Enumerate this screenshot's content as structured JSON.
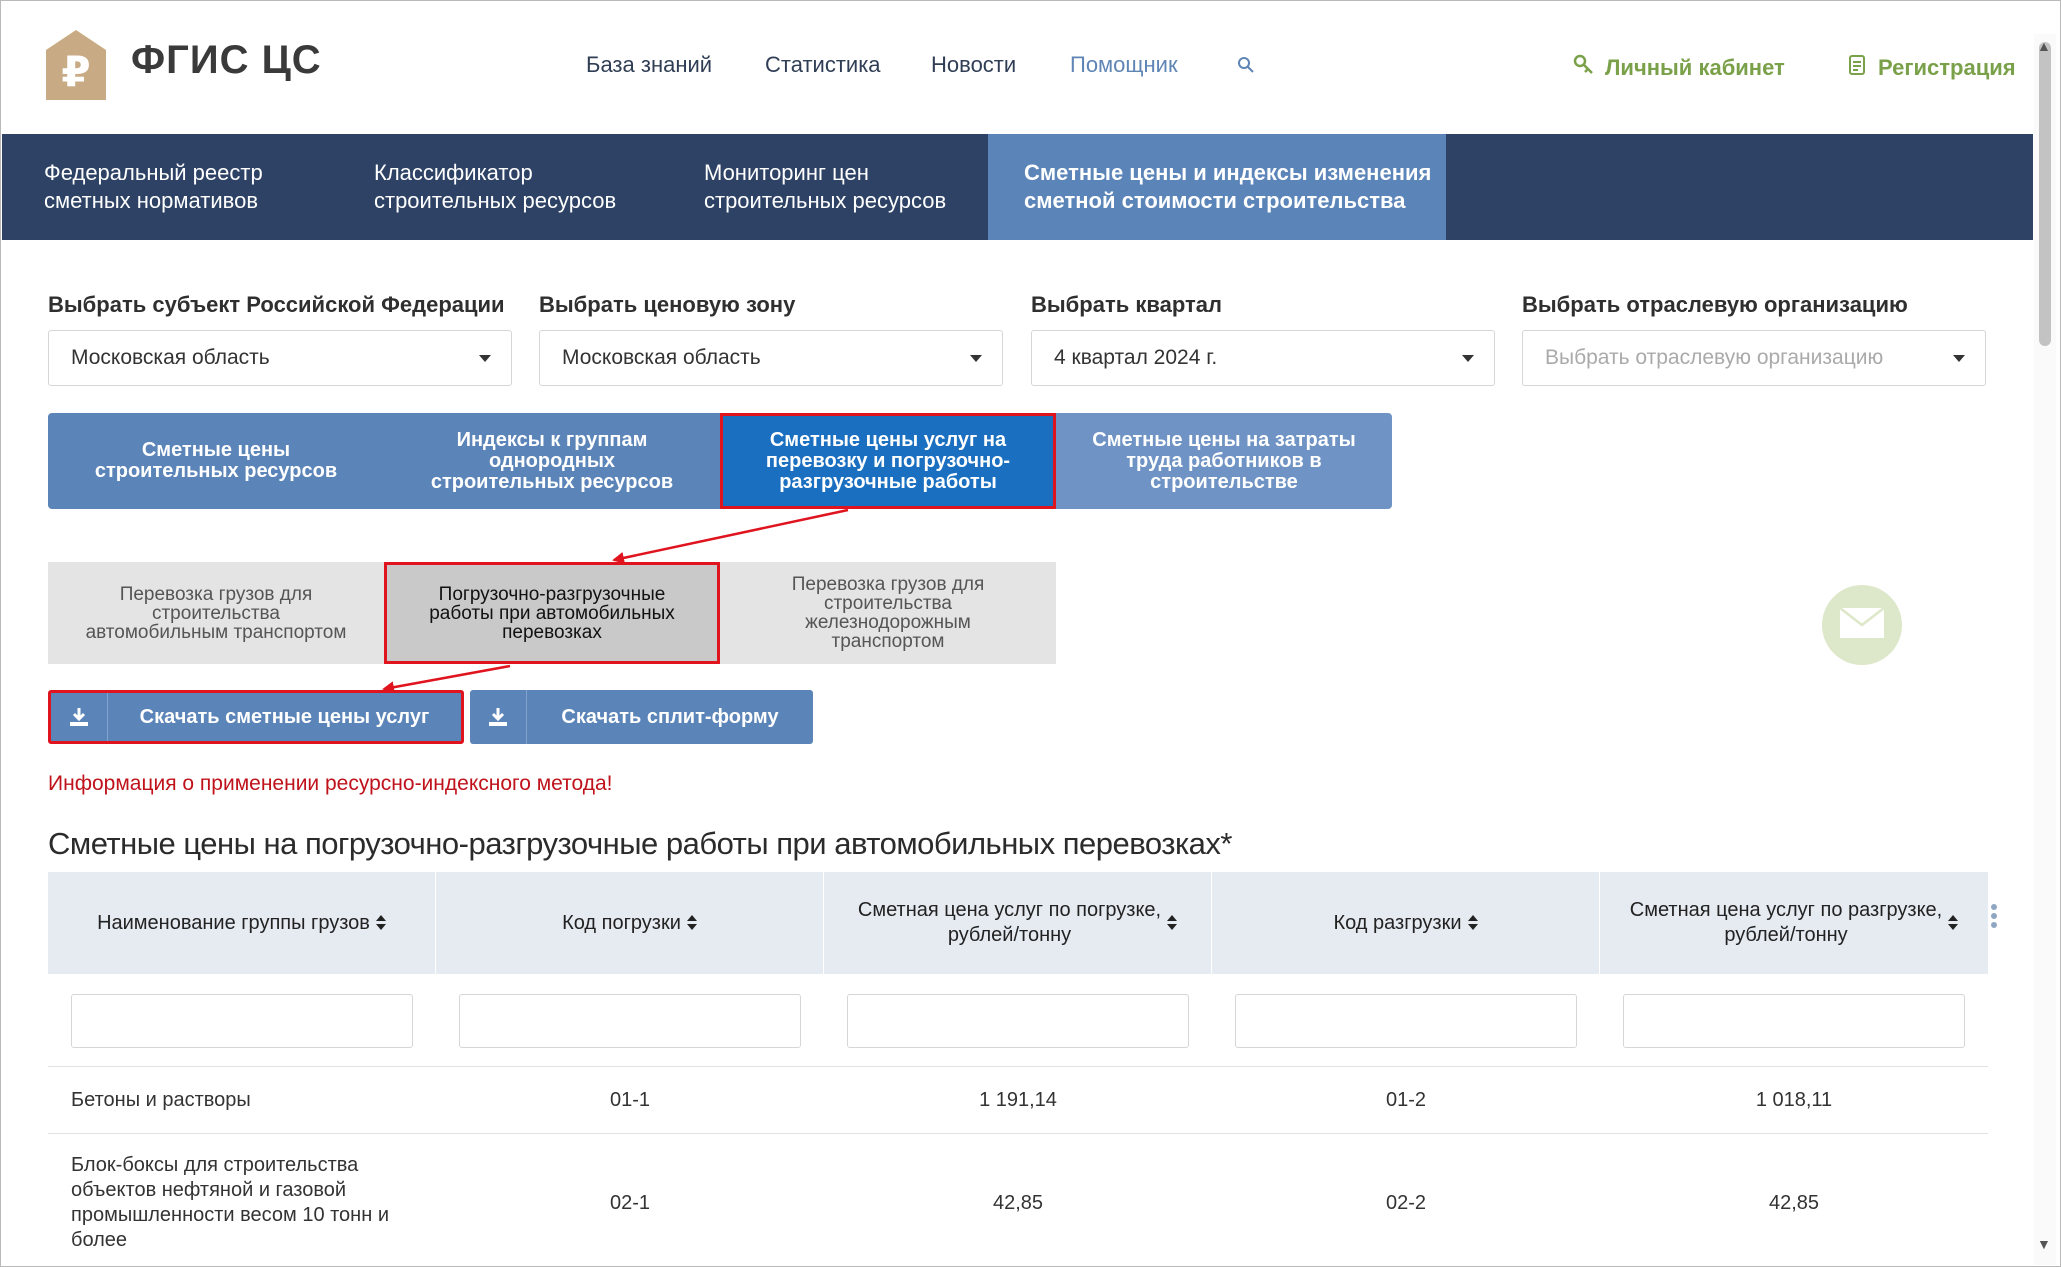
{
  "header": {
    "logo_text": "ФГИС ЦС",
    "nav": [
      "База знаний",
      "Статистика",
      "Новости",
      "Помощник"
    ],
    "account_label": "Личный кабинет",
    "register_label": "Регистрация"
  },
  "sections": [
    "Федеральный реестр\nсметных нормативов",
    "Классификатор\nстроительных ресурсов",
    "Мониторинг цен\nстроительных ресурсов",
    "Сметные цены и индексы изменения\nсметной стоимости строительства"
  ],
  "filters": {
    "region": {
      "label": "Выбрать субъект Российской Федерации",
      "value": "Московская область"
    },
    "zone": {
      "label": "Выбрать ценовую зону",
      "value": "Московская область"
    },
    "quarter": {
      "label": "Выбрать квартал",
      "value": "4 квартал 2024 г."
    },
    "org": {
      "label": "Выбрать отраслевую организацию",
      "placeholder": "Выбрать отраслевую организацию"
    }
  },
  "tabs_main": [
    "Сметные цены\nстроительных ресурсов",
    "Индексы к группам\nоднородных\nстроительных ресурсов",
    "Сметные цены услуг на\nперевозку и погрузочно-\nразгрузочные работы",
    "Сметные цены на затраты\nтруда работников в\nстроительстве"
  ],
  "tabs_sub": [
    "Перевозка грузов для\nстроительства\nавтомобильным транспортом",
    "Погрузочно-разгрузочные\nработы при автомобильных\nперевозках",
    "Перевозка грузов для\nстроительства\nжелезнодорожным\nтранспортом"
  ],
  "buttons": {
    "download_prices": "Скачать сметные цены услуг",
    "download_split": "Скачать сплит-форму"
  },
  "info_link": "Информация о применении ресурсно-индексного метода!",
  "table": {
    "title": "Сметные цены на погрузочно-разгрузочные работы при автомобильных перевозках*",
    "columns": [
      "Наименование группы грузов",
      "Код погрузки",
      "Сметная цена услуг по погрузке,\nрублей/тонну",
      "Код разгрузки",
      "Сметная цена услуг по разгрузке,\nрублей/тонну"
    ],
    "rows": [
      {
        "name": "Бетоны и растворы",
        "load_code": "01-1",
        "load_price": "1 191,14",
        "unload_code": "01-2",
        "unload_price": "1 018,11"
      },
      {
        "name": "Блок-боксы для строительства\nобъектов нефтяной и газовой\nпромышленности весом 10 тонн и\nболее",
        "load_code": "02-1",
        "load_price": "42,85",
        "unload_code": "02-2",
        "unload_price": "42,85"
      }
    ]
  },
  "colors": {
    "band": "#2d4264",
    "accent_blue": "#5b84b8",
    "active_tab": "#1a6fc0",
    "highlight_red": "#e0141e",
    "account_green": "#7aa14a",
    "info_red": "#c0121b"
  },
  "icons": [
    "logo-ruble-house-icon",
    "search-icon",
    "key-icon",
    "register-doc-icon",
    "download-icon",
    "sort-icon",
    "column-menu-icon",
    "mail-icon"
  ]
}
